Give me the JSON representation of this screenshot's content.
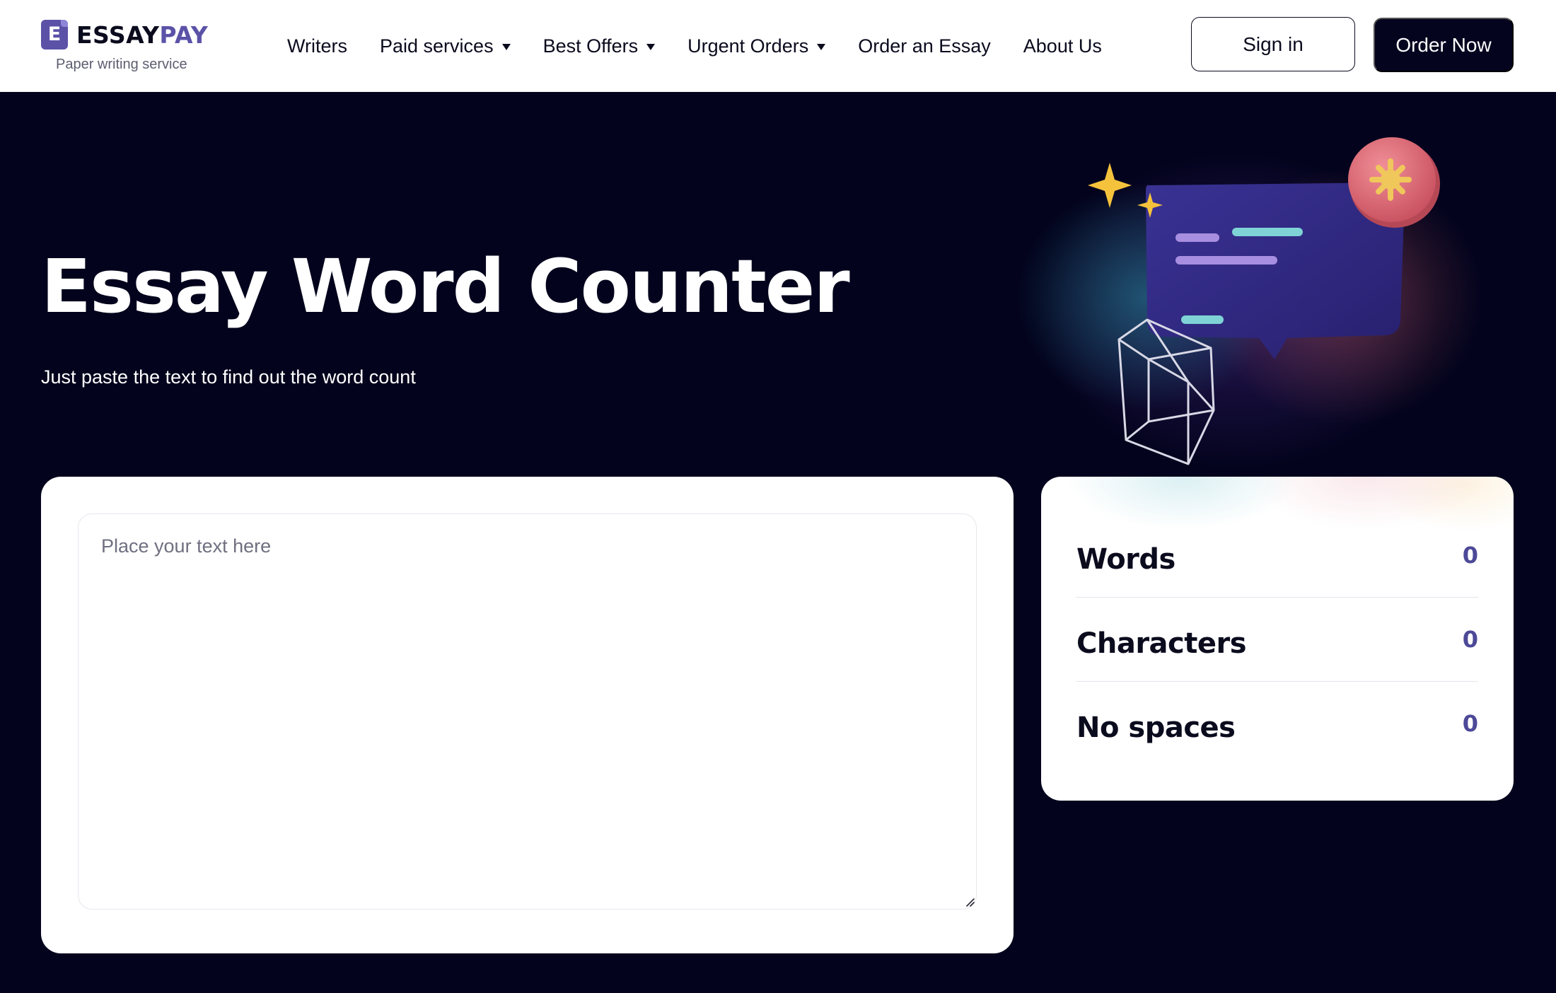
{
  "brand": {
    "name_part1": "ESSAY",
    "name_part2": "PAY",
    "mark_letter": "E",
    "tagline": "Paper writing service",
    "colors": {
      "accent": "#5b52a8",
      "dark": "#04041f"
    }
  },
  "nav": {
    "items": [
      {
        "label": "Writers",
        "has_dropdown": false
      },
      {
        "label": "Paid services",
        "has_dropdown": true
      },
      {
        "label": "Best Offers",
        "has_dropdown": true
      },
      {
        "label": "Urgent Orders",
        "has_dropdown": true
      },
      {
        "label": "Order an Essay",
        "has_dropdown": false
      },
      {
        "label": "About Us",
        "has_dropdown": false
      }
    ]
  },
  "header": {
    "sign_in_label": "Sign in",
    "order_now_label": "Order Now"
  },
  "hero": {
    "title": "Essay Word Counter",
    "subtitle": "Just paste the text to find out the word count"
  },
  "editor": {
    "placeholder": "Place your text here",
    "value": ""
  },
  "stats": {
    "words_label": "Words",
    "words_value": "0",
    "characters_label": "Characters",
    "characters_value": "0",
    "nospaces_label": "No spaces",
    "nospaces_value": "0"
  }
}
